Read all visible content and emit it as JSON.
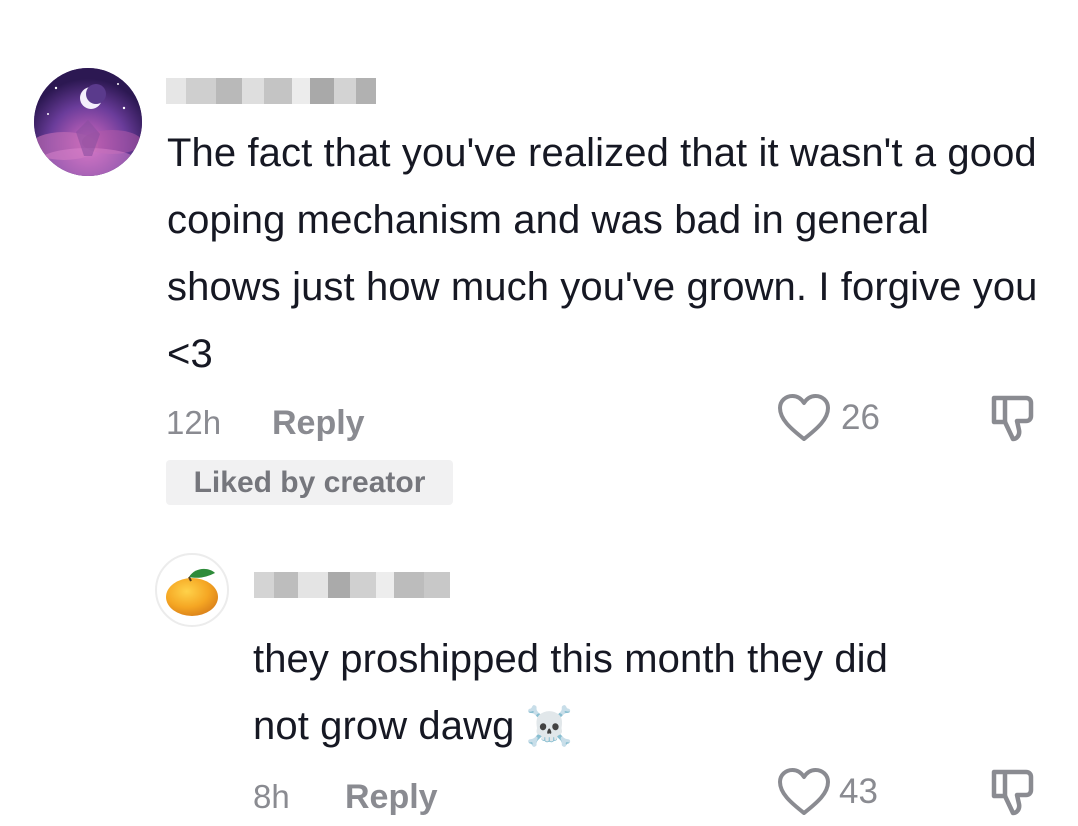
{
  "comments": [
    {
      "text": "The fact that you've realized that it wasn't a good coping mechanism and was bad in general shows just how much you've grown. I forgive you <3",
      "time": "12h",
      "reply_label": "Reply",
      "like_count": "26",
      "badge": "Liked by creator"
    },
    {
      "text_line1": "they proshipped this month they did",
      "text_line2": "not grow dawg",
      "emoji": "☠️",
      "time": "8h",
      "reply_label": "Reply",
      "like_count": "43"
    }
  ],
  "icons": {
    "heart": "heart-outline-icon",
    "dislike": "thumbs-down-icon",
    "avatar1": "moon-night-avatar",
    "avatar2": "mango-avatar"
  },
  "colors": {
    "text": "#161823",
    "muted": "#8a8b91",
    "badge_bg": "#f1f1f2"
  }
}
